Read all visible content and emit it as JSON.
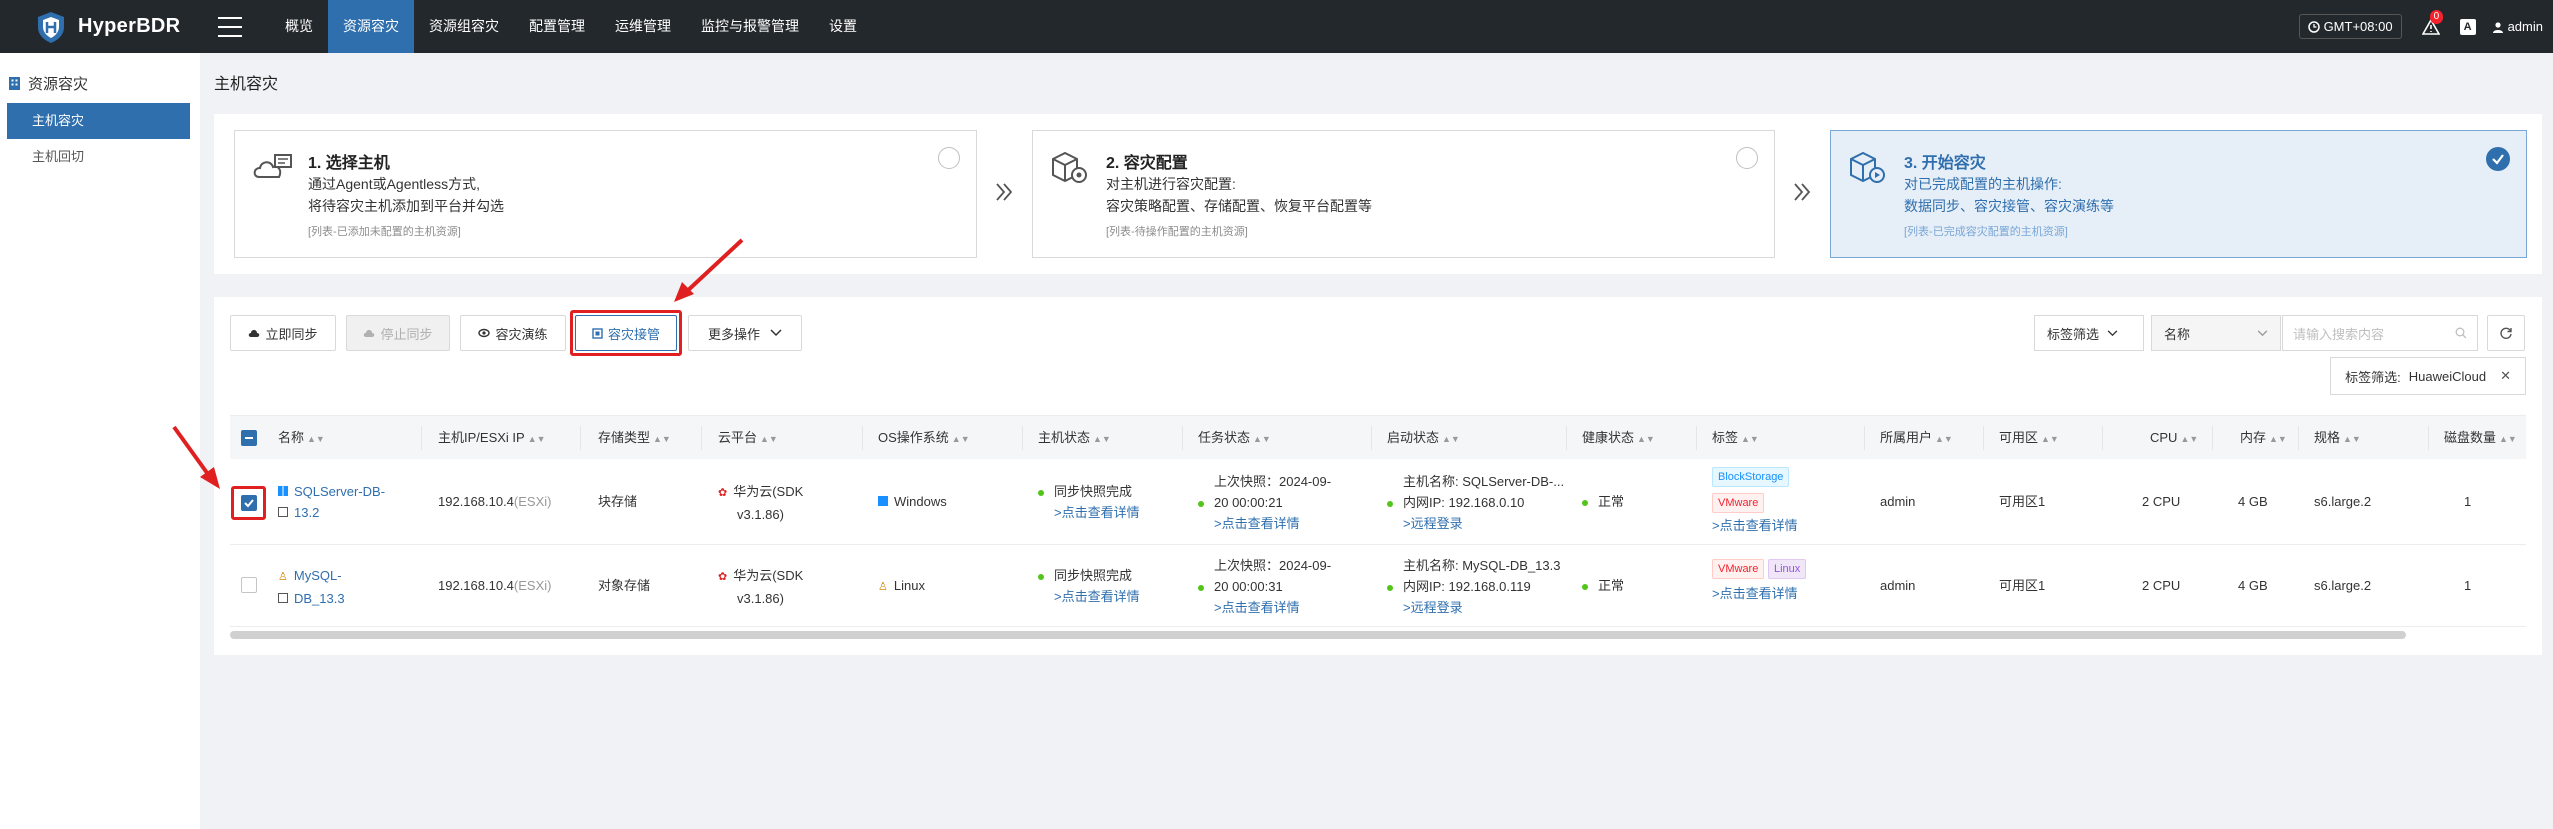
{
  "app": {
    "name": "HyperBDR"
  },
  "nav": [
    {
      "label": "概览",
      "active": false
    },
    {
      "label": "资源容灾",
      "active": true
    },
    {
      "label": "资源组容灾",
      "active": false
    },
    {
      "label": "配置管理",
      "active": false
    },
    {
      "label": "运维管理",
      "active": false
    },
    {
      "label": "监控与报警管理",
      "active": false
    },
    {
      "label": "设置",
      "active": false
    }
  ],
  "topbar": {
    "timezone": "GMT+08:00",
    "notifications": "0",
    "font_icon": "A",
    "user": "admin"
  },
  "sidebar": {
    "group": "资源容灾",
    "items": [
      {
        "label": "主机容灾",
        "active": true
      },
      {
        "label": "主机回切",
        "active": false
      }
    ]
  },
  "page": {
    "title": "主机容灾"
  },
  "steps": [
    {
      "title": "1. 选择主机",
      "desc1": "通过Agent或Agentless方式,",
      "desc2": "将待容灾主机添加到平台并勾选",
      "note": "[列表-已添加未配置的主机资源]",
      "icon": "cloud-host-icon"
    },
    {
      "title": "2. 容灾配置",
      "desc1": "对主机进行容灾配置:",
      "desc2": "容灾策略配置、存储配置、恢复平台配置等",
      "note": "[列表-待操作配置的主机资源]",
      "icon": "box-gear-icon"
    },
    {
      "title": "3. 开始容灾",
      "desc1": "对已完成配置的主机操作:",
      "desc2": "数据同步、容灾接管、容灾演练等",
      "note": "[列表-已完成容灾配置的主机资源]",
      "icon": "box-play-icon"
    }
  ],
  "toolbar": {
    "sync_now": "立即同步",
    "stop_sync": "停止同步",
    "drill": "容灾演练",
    "takeover": "容灾接管",
    "more": "更多操作",
    "tag_filter": "标签筛选",
    "field_select": "名称",
    "search_placeholder": "请输入搜索内容",
    "active_filter_label": "标签筛选:",
    "active_filter_value": "HuaweiCloud"
  },
  "table": {
    "headers": [
      "名称",
      "主机IP/ESXi IP",
      "存储类型",
      "云平台",
      "OS操作系统",
      "主机状态",
      "任务状态",
      "启动状态",
      "健康状态",
      "标签",
      "所属用户",
      "可用区",
      "CPU",
      "内存",
      "规格",
      "磁盘数量"
    ],
    "rows": [
      {
        "checked": true,
        "name1": "SQLServer-DB-",
        "name2": "13.2",
        "ip": "192.168.10.4",
        "ip_suffix": "(ESXi)",
        "storage": "块存储",
        "cloud1": "华为云(SDK",
        "cloud2": "v3.1.86)",
        "os": "Windows",
        "host_status": "同步快照完成",
        "host_link": ">点击查看详情",
        "task1": "上次快照：2024-09-",
        "task2": "20 00:00:21",
        "task_link": ">点击查看详情",
        "boot1": "主机名称: SQLServer-DB-...",
        "boot2": "内网IP: 192.168.0.10",
        "boot_link": ">远程登录",
        "health": "正常",
        "tags": [
          "BlockStorage",
          "VMware"
        ],
        "tag_link": ">点击查看详情",
        "owner": "admin",
        "zone": "可用区1",
        "cpu": "2 CPU",
        "mem": "4 GB",
        "spec": "s6.large.2",
        "disks": "1"
      },
      {
        "checked": false,
        "name1": "MySQL-",
        "name2": "DB_13.3",
        "ip": "192.168.10.4",
        "ip_suffix": "(ESXi)",
        "storage": "对象存储",
        "cloud1": "华为云(SDK",
        "cloud2": "v3.1.86)",
        "os": "Linux",
        "host_status": "同步快照完成",
        "host_link": ">点击查看详情",
        "task1": "上次快照：2024-09-",
        "task2": "20 00:00:31",
        "task_link": ">点击查看详情",
        "boot1": "主机名称: MySQL-DB_13.3",
        "boot2": "内网IP: 192.168.0.119",
        "boot_link": ">远程登录",
        "health": "正常",
        "tags": [
          "VMware",
          "Linux"
        ],
        "tag_link": ">点击查看详情",
        "owner": "admin",
        "zone": "可用区1",
        "cpu": "2 CPU",
        "mem": "4 GB",
        "spec": "s6.large.2",
        "disks": "1"
      }
    ]
  },
  "colors": {
    "topbar": "#23282d",
    "accent": "#2f6fae",
    "highlight": "#e02020"
  }
}
